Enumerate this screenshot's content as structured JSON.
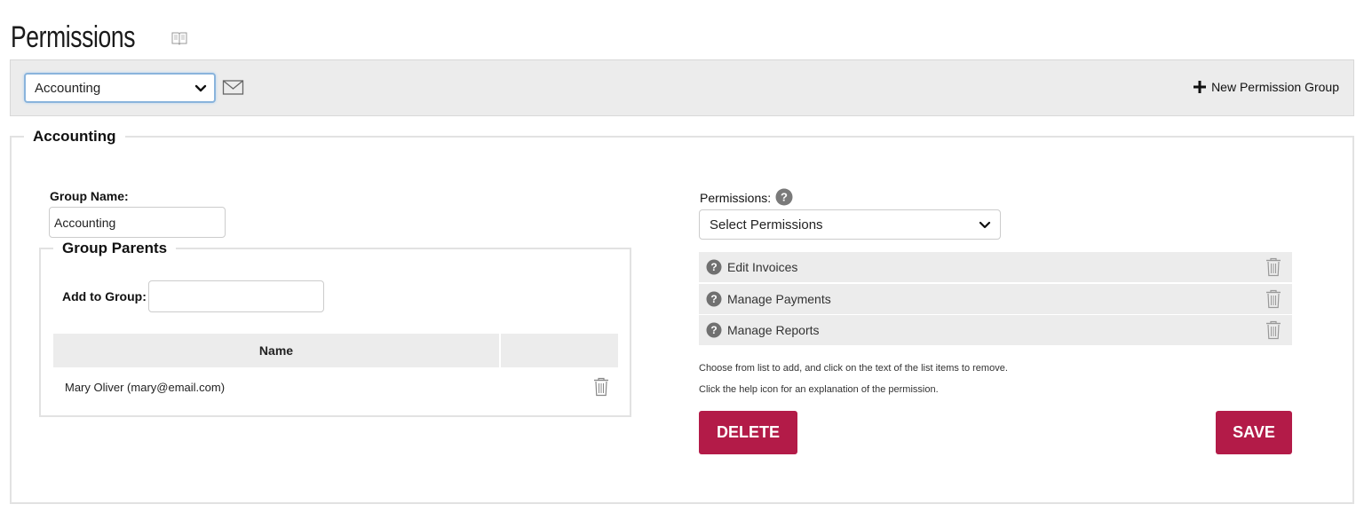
{
  "page": {
    "title": "Permissions"
  },
  "toolbar": {
    "group_select_value": "Accounting",
    "new_group_label": "New Permission Group"
  },
  "group": {
    "legend": "Accounting",
    "name_label": "Group Name:",
    "name_value": "Accounting",
    "parents": {
      "legend": "Group Parents",
      "add_label": "Add to Group:",
      "add_value": "",
      "table": {
        "columns": [
          "Name",
          ""
        ],
        "rows": [
          {
            "name": "Mary Oliver (mary@email.com)"
          }
        ]
      }
    }
  },
  "permissions": {
    "label": "Permissions:",
    "select_placeholder": "Select Permissions",
    "items": [
      {
        "label": "Edit Invoices"
      },
      {
        "label": "Manage Payments"
      },
      {
        "label": "Manage Reports"
      }
    ],
    "hint_1": "Choose from list to add, and click on the text of the list items to remove.",
    "hint_2": "Click the help icon for an explanation of the permission."
  },
  "actions": {
    "delete_label": "DELETE",
    "save_label": "SAVE"
  },
  "colors": {
    "primary_button": "#b31b48",
    "toolbar_bg": "#ececec",
    "focus_border": "#8ab4dc"
  },
  "icons": [
    "book-icon",
    "mail-icon",
    "plus-icon",
    "chevron-down-icon",
    "help-icon",
    "trash-icon"
  ]
}
